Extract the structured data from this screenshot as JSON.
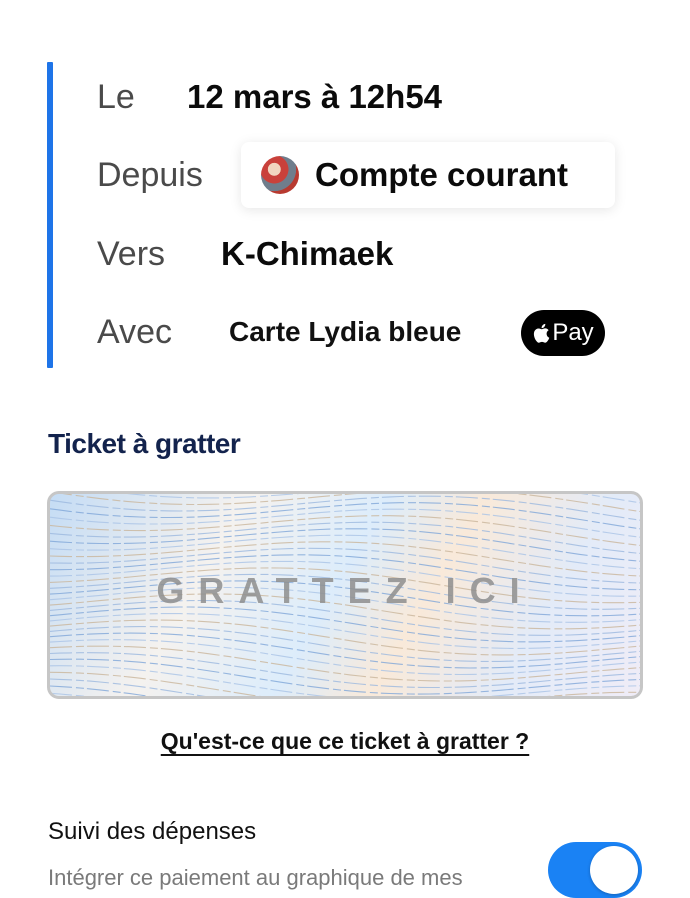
{
  "details": {
    "date": {
      "label": "Le",
      "value": "12 mars à 12h54"
    },
    "from": {
      "label": "Depuis",
      "value": "Compte courant"
    },
    "to": {
      "label": "Vers",
      "value": "K-Chimaek"
    },
    "with": {
      "label": "Avec",
      "value": "Carte Lydia bleue",
      "badge": "Pay",
      "badge_icon": "apple-logo-icon"
    }
  },
  "ticket": {
    "title": "Ticket à gratter",
    "scratch_label": "GRATTEZ ICI",
    "help_link": "Qu'est-ce que ce ticket à gratter ?"
  },
  "tracking": {
    "title": "Suivi des dépenses",
    "description": "Intégrer ce paiement au graphique de mes",
    "enabled": true
  },
  "colors": {
    "accent": "#1e74e8",
    "toggle": "#1a82f4",
    "section_title": "#13234d"
  }
}
